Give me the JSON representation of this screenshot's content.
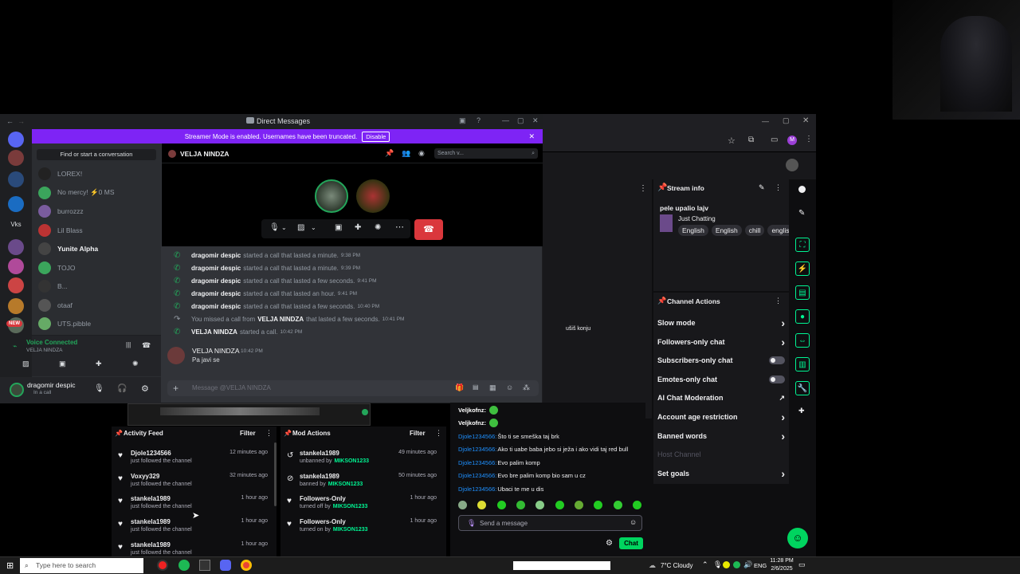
{
  "discord": {
    "window_title": "Direct Messages",
    "banner_text": "Streamer Mode is enabled. Usernames have been truncated.",
    "banner_button": "Disable",
    "find_conversation": "Find or start a conversation",
    "dms": [
      {
        "name": "LOREX!",
        "color": "#222"
      },
      {
        "name": "No mercy! ⚡0 MS",
        "color": "#3ba55c"
      },
      {
        "name": "burrozzz",
        "color": "#7a5c9e"
      },
      {
        "name": "Lil Blass",
        "color": "#b33"
      },
      {
        "name": "Yunite Alpha",
        "color": "#444"
      },
      {
        "name": "TOJO",
        "color": "#3ba55c"
      },
      {
        "name": "B...",
        "color": "#333"
      },
      {
        "name": "otaaf",
        "color": "#555"
      },
      {
        "name": "UTS.pibble",
        "color": "#6a6"
      }
    ],
    "voice_status": "Voice Connected",
    "voice_channel": "VELJA NINDZA",
    "user_name": "dragomir despic",
    "user_status": "In a call",
    "chat_header": "VELJA NINDZA",
    "search_placeholder": "Search v...",
    "messages": [
      {
        "name": "dragomir despic",
        "text": "started a call that lasted a minute.",
        "time": "9:38 PM",
        "missed": false
      },
      {
        "name": "dragomir despic",
        "text": "started a call that lasted a minute.",
        "time": "9:39 PM",
        "missed": false
      },
      {
        "name": "dragomir despic",
        "text": "started a call that lasted a few seconds.",
        "time": "9:41 PM",
        "missed": false
      },
      {
        "name": "dragomir despic",
        "text": "started a call that lasted an hour.",
        "time": "9:41 PM",
        "missed": false
      },
      {
        "name": "dragomir despic",
        "text": "started a call that lasted a few seconds.",
        "time": "10:40 PM",
        "missed": false
      },
      {
        "name": "",
        "text": "You missed a call from",
        "name2": "VELJA NINDZA",
        "text2": "that lasted a few seconds.",
        "time": "10:41 PM",
        "missed": true
      },
      {
        "name": "VELJA NINDZA",
        "text": "started a call.",
        "time": "10:42 PM",
        "missed": false
      }
    ],
    "last_author": "VELJA NINDZA",
    "last_time": "10:42 PM",
    "last_text": "Pa javi se",
    "message_placeholder": "Message @VELJA NINDZA"
  },
  "twitch": {
    "stream_info_title": "Stream info",
    "stream_title": "pele upalio lajv",
    "category": "Just Chatting",
    "tags": [
      "English",
      "English",
      "chill",
      "englis"
    ],
    "channel_actions_title": "Channel Actions",
    "actions": [
      {
        "label": "Slow mode",
        "control": "arrow"
      },
      {
        "label": "Followers-only chat",
        "control": "arrow"
      },
      {
        "label": "Subscribers-only chat",
        "control": "toggle"
      },
      {
        "label": "Emotes-only chat",
        "control": "toggle"
      },
      {
        "label": "AI Chat Moderation",
        "control": "link"
      },
      {
        "label": "Account age restriction",
        "control": "arrow"
      },
      {
        "label": "Banned words",
        "control": "arrow"
      },
      {
        "label": "Host Channel",
        "control": "none"
      },
      {
        "label": "Set goals",
        "control": "arrow"
      }
    ],
    "partial_chat_text": "ušiš konju",
    "activity_feed_title": "Activity Feed",
    "filter_label": "Filter",
    "activity": [
      {
        "name": "Djole1234566",
        "sub": "just followed the channel",
        "time": "12 minutes ago"
      },
      {
        "name": "Voxyy329",
        "sub": "just followed the channel",
        "time": "32 minutes ago"
      },
      {
        "name": "stankela1989",
        "sub": "just followed the channel",
        "time": "1 hour ago"
      },
      {
        "name": "stankela1989",
        "sub": "just followed the channel",
        "time": "1 hour ago"
      },
      {
        "name": "stankela1989",
        "sub": "just followed the channel",
        "time": "1 hour ago"
      }
    ],
    "mod_actions_title": "Mod Actions",
    "mod": [
      {
        "name": "stankela1989",
        "pre": "unbanned by",
        "by": "MIKSON1233",
        "time": "49 minutes ago"
      },
      {
        "name": "stankela1989",
        "pre": "banned by",
        "by": "MIKSON1233",
        "time": "50 minutes ago"
      },
      {
        "name": "Followers-Only",
        "pre": "turned off by",
        "by": "MIKSON1233",
        "time": "1 hour ago"
      },
      {
        "name": "Followers-Only",
        "pre": "turned on by",
        "by": "MIKSON1233",
        "time": "1 hour ago"
      }
    ],
    "chat_lines": [
      {
        "user": "Veljkofnz:",
        "text": ""
      },
      {
        "user": "Veljkofnz:",
        "text": ""
      },
      {
        "user": "Djole1234566:",
        "text": "Što ti se smeška taj brk"
      },
      {
        "user": "Djole1234566:",
        "text": "Ako ti uabe baba jebo si ježa i ako vidi taj red bull"
      },
      {
        "user": "Djole1234566:",
        "text": "Evo palim komp"
      },
      {
        "user": "Djole1234566:",
        "text": "Evo bre palim komp bio sam u cz"
      },
      {
        "user": "Djole1234566:",
        "text": "Ubaci te me u dis"
      }
    ],
    "send_placeholder": "Send a message",
    "chat_button": "Chat"
  },
  "taskbar": {
    "search_placeholder": "Type here to search",
    "weather": "7°C Cloudy",
    "lang": "ENG",
    "time": "11:28 PM",
    "date": "2/6/2025"
  }
}
